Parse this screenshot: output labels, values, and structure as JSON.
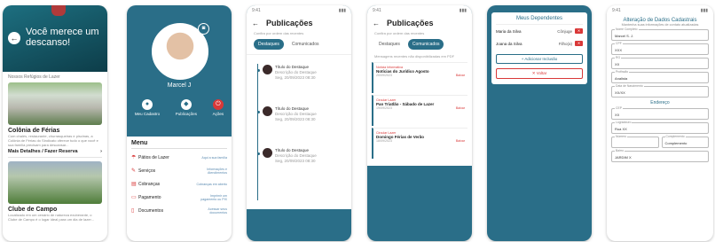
{
  "phone1": {
    "title": "Você merece um descanso!",
    "section": "Nossos Refúgios de Lazer",
    "cards": [
      {
        "title": "Colônia de Férias",
        "desc": "Com chalés, restaurante, churrasqueiras e piscinas, a Colônia de Férias do Sindicato oferece tudo o que você e sua família precisam para descansar...",
        "more": "Mais Detalhes / Fazer Reserva"
      },
      {
        "title": "Clube de Campo",
        "desc": "Localizado em um cenário de natureza exuberante, o Clube de Campo é o lugar ideal para um dia de lazer...",
        "more": ""
      }
    ]
  },
  "phone2": {
    "name": "Marcel J",
    "actions": [
      "Meu Cadastro",
      "Publicações",
      "Ações"
    ],
    "menu_title": "Menu",
    "menu": [
      {
        "label": "Pátios de Lazer",
        "desc": "Aqui a sua família"
      },
      {
        "label": "Serviços",
        "desc": "Informações e Atendimentos"
      },
      {
        "label": "Cobranças",
        "desc": "Cobranças em aberto"
      },
      {
        "label": "Pagamento",
        "desc": "Imprimir um pagamento ou PIX"
      },
      {
        "label": "Documentos",
        "desc": "Acessar seus documentos"
      }
    ]
  },
  "phone3": {
    "title": "Publicações",
    "subtitle": "Confira por ordem das recentes",
    "tabs": [
      "Destaques",
      "Comunicados"
    ],
    "items": [
      {
        "title": "Título do Destaque",
        "desc": "Descrição do Destaque",
        "date": "Seg, 20/09/2023 08:30"
      },
      {
        "title": "Título do Destaque",
        "desc": "Descrição do Destaque",
        "date": "Seg, 20/09/2023 08:30"
      },
      {
        "title": "Título do Destaque",
        "desc": "Descrição do Destaque",
        "date": "Seg, 20/09/2023 08:30"
      }
    ]
  },
  "phone4": {
    "title": "Publicações",
    "subtitle": "Confira por ordem das recentes",
    "tabs": [
      "Destaques",
      "Comunicados"
    ],
    "note": "Mensagens recentes não disponibilizadas em PDF",
    "items": [
      {
        "cat": "Notícia Informativa",
        "title": "Notícias do Jurídico Agosto",
        "date": "20/09/2023",
        "action": "Baixar"
      },
      {
        "cat": "Circular Lazer",
        "title": "Pan Triatlão - Sábado de Lazer",
        "date": "19/09/2023",
        "action": "Baixar"
      },
      {
        "cat": "Circular Lazer",
        "title": "Domingo Férias de Verão",
        "date": "18/09/2023",
        "action": "Baixar"
      }
    ]
  },
  "phone5": {
    "title": "Meus Dependentes",
    "deps": [
      {
        "name": "Maria da Silva",
        "rel": "Cônjuge",
        "x": "✕"
      },
      {
        "name": "Joana da Silva",
        "rel": "Filho(a)",
        "x": "✕"
      }
    ],
    "add": "+ Adicionar Inclusão",
    "back": "✕ Voltar"
  },
  "phone6": {
    "title": "Alteração de Dados Cadastrais",
    "subtitle": "Mantenha suas informações de contato atualizadas",
    "fields": [
      {
        "label": "Nome Completo",
        "value": "Marcel S. J."
      },
      {
        "label": "CPF",
        "value": "XXX"
      },
      {
        "label": "RG",
        "value": "XX"
      },
      {
        "label": "Profissão",
        "value": "Analista"
      },
      {
        "label": "Data de Nascimento",
        "value": "XX/XX"
      }
    ],
    "address_title": "Endereço",
    "address": [
      {
        "label": "CEP",
        "value": "XX"
      },
      {
        "label": "Logradouro",
        "value": "Rua XX"
      }
    ],
    "row": [
      {
        "label": "Número",
        "value": ""
      },
      {
        "label": "Complemento",
        "value": "Complemento"
      }
    ],
    "last": {
      "label": "Bairro",
      "value": "JARDIM X"
    }
  }
}
